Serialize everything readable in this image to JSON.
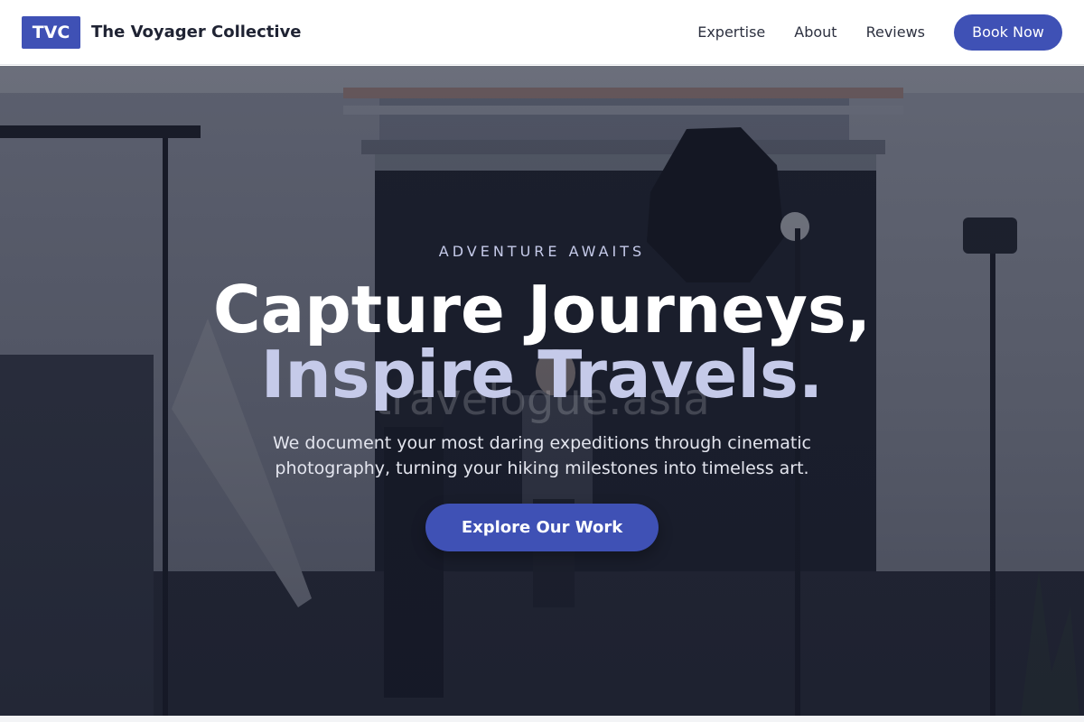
{
  "header": {
    "logo_text": "TVC",
    "brand_name": "The Voyager Collective",
    "nav": [
      "Expertise",
      "About",
      "Reviews"
    ],
    "cta_label": "Book Now"
  },
  "hero": {
    "eyebrow": "ADVENTURE AWAITS",
    "headline_line1": "Capture Journeys,",
    "headline_line2": "Inspire Travels.",
    "watermark": "travelogue.asia",
    "subtext": "We document your most daring expeditions through cinematic photography, turning your hiking milestones into timeless art.",
    "cta_label": "Explore Our Work"
  },
  "colors": {
    "accent": "#3f51b5",
    "accent_light": "#c5cae9",
    "header_bg": "#ffffff",
    "text_dark": "#1f2333"
  }
}
